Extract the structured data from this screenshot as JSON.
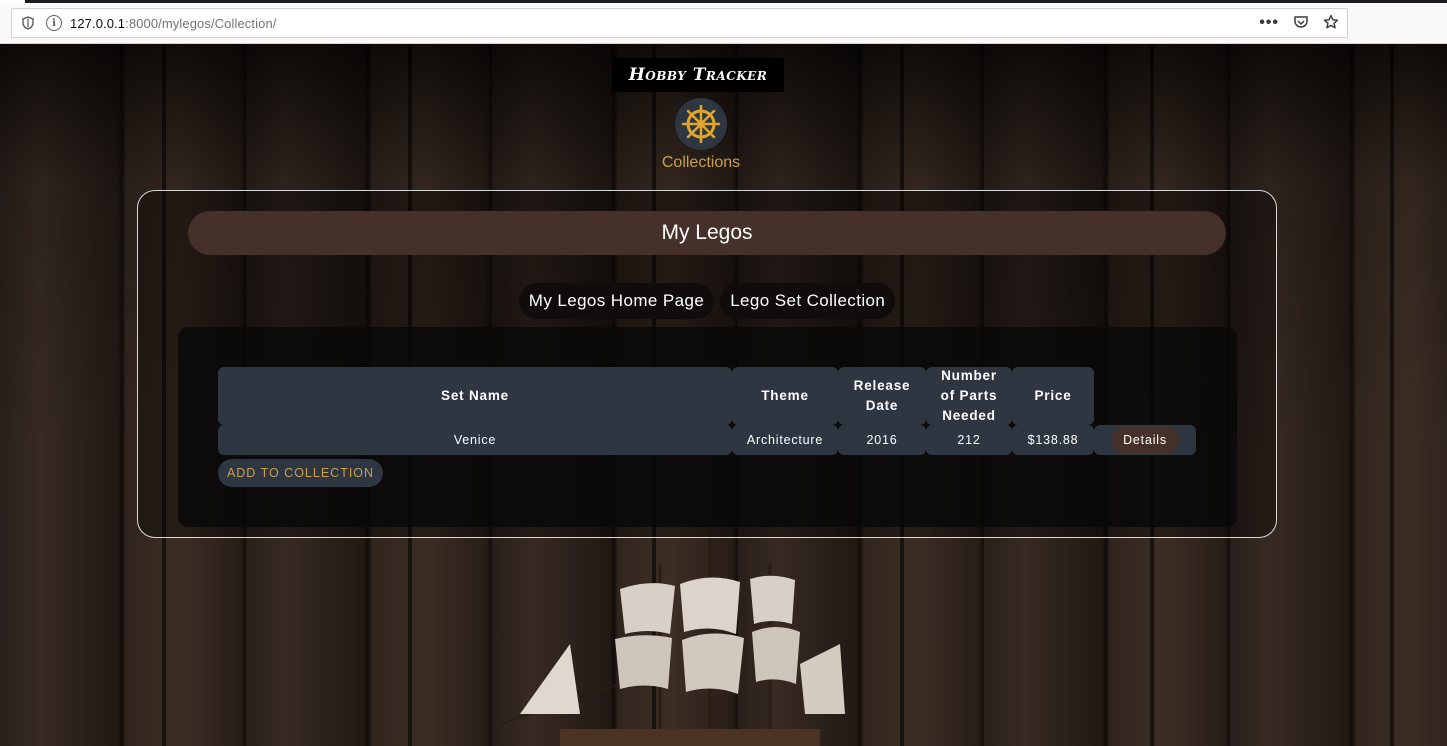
{
  "browser": {
    "url_host": "127.0.0.1",
    "url_path": ":8000/mylegos/Collection/",
    "menu_dots": "•••"
  },
  "header": {
    "brand": "Hobby Tracker",
    "nav_label": "Collections"
  },
  "panel": {
    "title": "My Legos",
    "links": [
      "My Legos Home Page",
      "Lego Set Collection"
    ]
  },
  "table": {
    "columns": [
      "Set Name",
      "Theme",
      "Release Date",
      "Number of Parts Needed",
      "Price"
    ],
    "rows": [
      {
        "set_name": "Venice",
        "theme": "Architecture",
        "release_date": "2016",
        "parts": "212",
        "price": "$138.88",
        "action": "Details"
      }
    ]
  },
  "add_button": "ADD TO COLLECTION",
  "colors": {
    "accent_gold": "#c8a04c",
    "title_brown": "#46302a",
    "cell_slate": "#2e3641"
  }
}
